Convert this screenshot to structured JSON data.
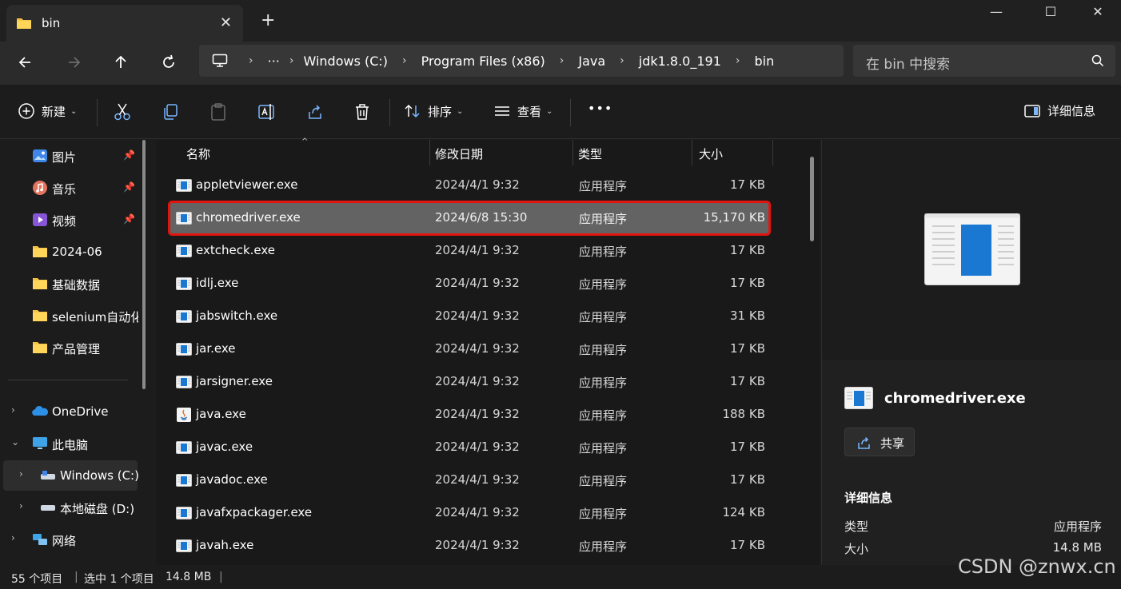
{
  "window": {
    "tab_title": "bin",
    "tab_close": "✕",
    "new_tab": "+",
    "minimize": "—",
    "maximize": "☐",
    "close": "✕"
  },
  "address": {
    "more": "···",
    "crumbs": [
      "Windows (C:)",
      "Program Files (x86)",
      "Java",
      "jdk1.8.0_191",
      "bin"
    ],
    "search_placeholder": "在 bin 中搜索"
  },
  "toolbar": {
    "new_label": "新建",
    "sort_label": "排序",
    "view_label": "查看",
    "more": "•••",
    "details_label": "详细信息"
  },
  "sidebar": {
    "items": [
      {
        "label": "图片",
        "icon": "pictures-icon",
        "pinned": true
      },
      {
        "label": "音乐",
        "icon": "music-icon",
        "pinned": true
      },
      {
        "label": "视频",
        "icon": "videos-icon",
        "pinned": true
      },
      {
        "label": "2024-06",
        "icon": "folder-icon"
      },
      {
        "label": "基础数据",
        "icon": "folder-icon"
      },
      {
        "label": "selenium自动化",
        "icon": "folder-icon"
      },
      {
        "label": "产品管理",
        "icon": "folder-icon"
      },
      {
        "label": "OneDrive",
        "icon": "onedrive-icon"
      },
      {
        "label": "此电脑",
        "icon": "this-pc-icon"
      },
      {
        "label": "Windows (C:)",
        "icon": "drive-icon"
      },
      {
        "label": "本地磁盘 (D:)",
        "icon": "drive-icon"
      },
      {
        "label": "网络",
        "icon": "network-icon"
      }
    ]
  },
  "columns": {
    "name": "名称",
    "date": "修改日期",
    "type": "类型",
    "size": "大小"
  },
  "files": [
    {
      "name": "appletviewer.exe",
      "date": "2024/4/1 9:32",
      "type": "应用程序",
      "size": "17 KB"
    },
    {
      "name": "chromedriver.exe",
      "date": "2024/6/8 15:30",
      "type": "应用程序",
      "size": "15,170 KB",
      "selected": true
    },
    {
      "name": "extcheck.exe",
      "date": "2024/4/1 9:32",
      "type": "应用程序",
      "size": "17 KB"
    },
    {
      "name": "idlj.exe",
      "date": "2024/4/1 9:32",
      "type": "应用程序",
      "size": "17 KB"
    },
    {
      "name": "jabswitch.exe",
      "date": "2024/4/1 9:32",
      "type": "应用程序",
      "size": "31 KB"
    },
    {
      "name": "jar.exe",
      "date": "2024/4/1 9:32",
      "type": "应用程序",
      "size": "17 KB"
    },
    {
      "name": "jarsigner.exe",
      "date": "2024/4/1 9:32",
      "type": "应用程序",
      "size": "17 KB"
    },
    {
      "name": "java.exe",
      "date": "2024/4/1 9:32",
      "type": "应用程序",
      "size": "188 KB",
      "icon": "java"
    },
    {
      "name": "javac.exe",
      "date": "2024/4/1 9:32",
      "type": "应用程序",
      "size": "17 KB"
    },
    {
      "name": "javadoc.exe",
      "date": "2024/4/1 9:32",
      "type": "应用程序",
      "size": "17 KB"
    },
    {
      "name": "javafxpackager.exe",
      "date": "2024/4/1 9:32",
      "type": "应用程序",
      "size": "124 KB"
    },
    {
      "name": "javah.exe",
      "date": "2024/4/1 9:32",
      "type": "应用程序",
      "size": "17 KB"
    }
  ],
  "details": {
    "file_name": "chromedriver.exe",
    "share_label": "共享",
    "section_title": "详细信息",
    "rows": [
      {
        "key": "类型",
        "value": "应用程序"
      },
      {
        "key": "大小",
        "value": "14.8 MB"
      }
    ]
  },
  "status": {
    "count": "55 个项目",
    "selected": "选中 1 个项目",
    "size": "14.8 MB"
  },
  "watermark": "CSDN @znwx.cn"
}
